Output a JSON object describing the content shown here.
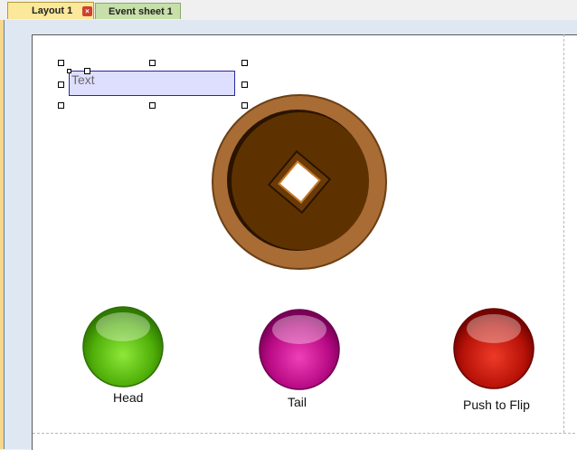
{
  "tabs": [
    {
      "label": "Layout 1"
    },
    {
      "label": "Event sheet 1"
    }
  ],
  "tab_close_glyph": "×",
  "text_object": {
    "content": "Text"
  },
  "buttons": {
    "head": {
      "label": "Head",
      "color": "#5cc20e"
    },
    "tail": {
      "label": "Tail",
      "color": "#c0108a"
    },
    "flip": {
      "label": "Push to Flip",
      "color": "#c8140a"
    }
  },
  "coin": {
    "rim_color": "#a86c34",
    "face_color": "#5e3200"
  }
}
